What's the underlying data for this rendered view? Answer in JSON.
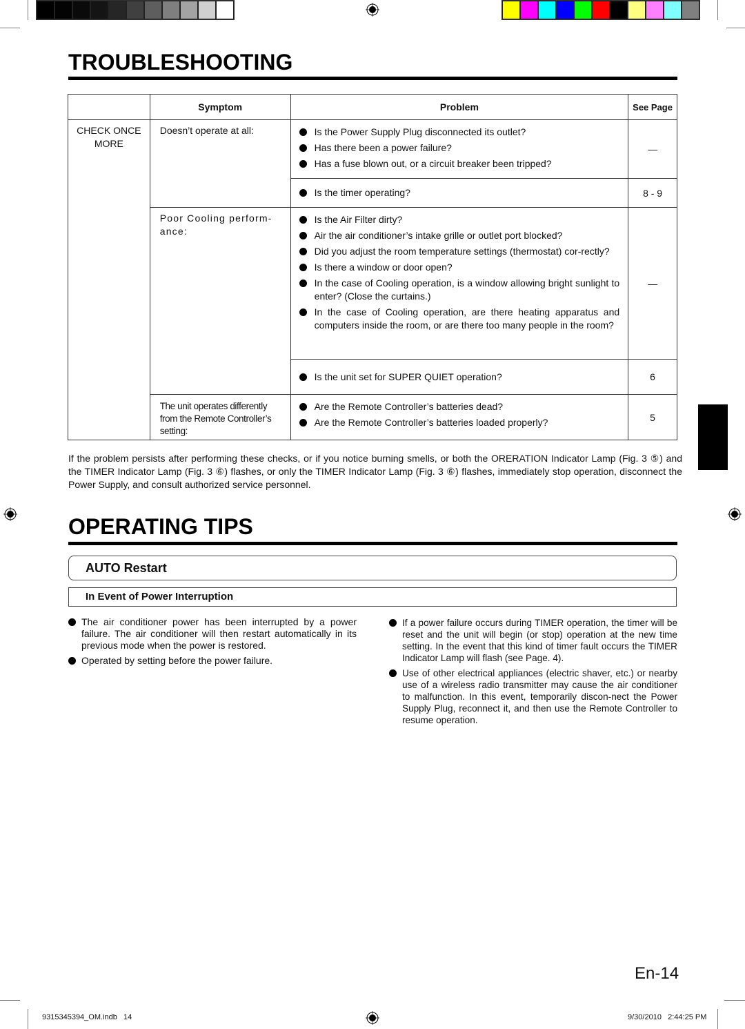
{
  "print_marks": {
    "grayscale_bar": [
      "#000000",
      "#030303",
      "#0a0a0a",
      "#141414",
      "#262626",
      "#404040",
      "#5e5e5e",
      "#7f7f7f",
      "#a3a3a3",
      "#d0d0d0",
      "#ffffff"
    ],
    "color_bar": [
      "#ffff00",
      "#ff00ff",
      "#00ffff",
      "#0000ff",
      "#00ff00",
      "#ff0000",
      "#000000",
      "#ffff80",
      "#ff80ff",
      "#80ffff",
      "#808080"
    ]
  },
  "troubleshooting": {
    "title": "TROUBLESHOOTING",
    "headers": {
      "symptom": "Symptom",
      "problem": "Problem",
      "see_page": "See Page"
    },
    "check_label_line1": "CHECK ONCE",
    "check_label_line2": "MORE",
    "rows": [
      {
        "symptom": "Doesn’t operate at all:",
        "groups": [
          {
            "problems": [
              "Is the Power Supply Plug disconnected its outlet?",
              "Has there been a power failure?",
              "Has a fuse blown out, or a circuit breaker been tripped?"
            ],
            "see_page": "—"
          },
          {
            "problems": [
              "Is the timer operating?"
            ],
            "see_page": "8 - 9"
          }
        ]
      },
      {
        "symptom": "Poor Cooling perform-ance:",
        "groups": [
          {
            "problems": [
              "Is the Air Filter dirty?",
              "Air the air conditioner’s intake grille or outlet port blocked?",
              "Did you adjust the room temperature settings (thermostat) cor-rectly?",
              "Is there a window or door open?",
              "In the case of Cooling operation, is a window allowing bright sunlight to enter? (Close the curtains.)",
              "In the case of Cooling operation, are there heating apparatus and computers inside the room, or are there too many people in the room?"
            ],
            "see_page": "—"
          },
          {
            "problems": [
              "Is the unit set for SUPER QUIET operation?"
            ],
            "see_page": "6"
          }
        ]
      },
      {
        "symptom": "The unit operates differently from the Remote Controller’s setting:",
        "groups": [
          {
            "problems": [
              "Are the Remote Controller’s batteries dead?",
              "Are the Remote Controller’s batteries loaded properly?"
            ],
            "see_page": "5"
          }
        ]
      }
    ],
    "note": "If the problem persists after performing these checks, or if you notice burning smells, or both the ORERATION Indicator Lamp (Fig. 3 ⑤) and the TIMER Indicator Lamp (Fig. 3 ⑥) flashes, or only the TIMER Indicator Lamp (Fig. 3 ⑥) flashes, immediately stop operation, disconnect the Power Supply, and consult authorized service personnel."
  },
  "operating_tips": {
    "title": "OPERATING TIPS",
    "section": "AUTO Restart",
    "subsection": "In Event of Power Interruption",
    "left_items": [
      "The air conditioner power has been interrupted by a power failure. The air conditioner will then restart automatically in its previous mode when the power is restored.",
      "Operated by setting before the power failure."
    ],
    "right_items": [
      "If a power failure occurs during TIMER operation, the timer will be reset and the unit will begin (or stop) operation at the new time setting. In the event that this kind of timer fault occurs the TIMER Indicator Lamp will flash (see Page. 4).",
      "Use of other electrical appliances (electric shaver, etc.) or nearby use of a wireless radio transmitter may cause the air conditioner to malfunction. In this event, temporarily discon-nect the Power Supply Plug, reconnect it, and then use the Remote Controller to resume operation."
    ]
  },
  "page_number": "En-14",
  "footer": {
    "file": "9315345394_OM.indb   14",
    "timestamp": "9/30/2010   2:44:25 PM"
  }
}
